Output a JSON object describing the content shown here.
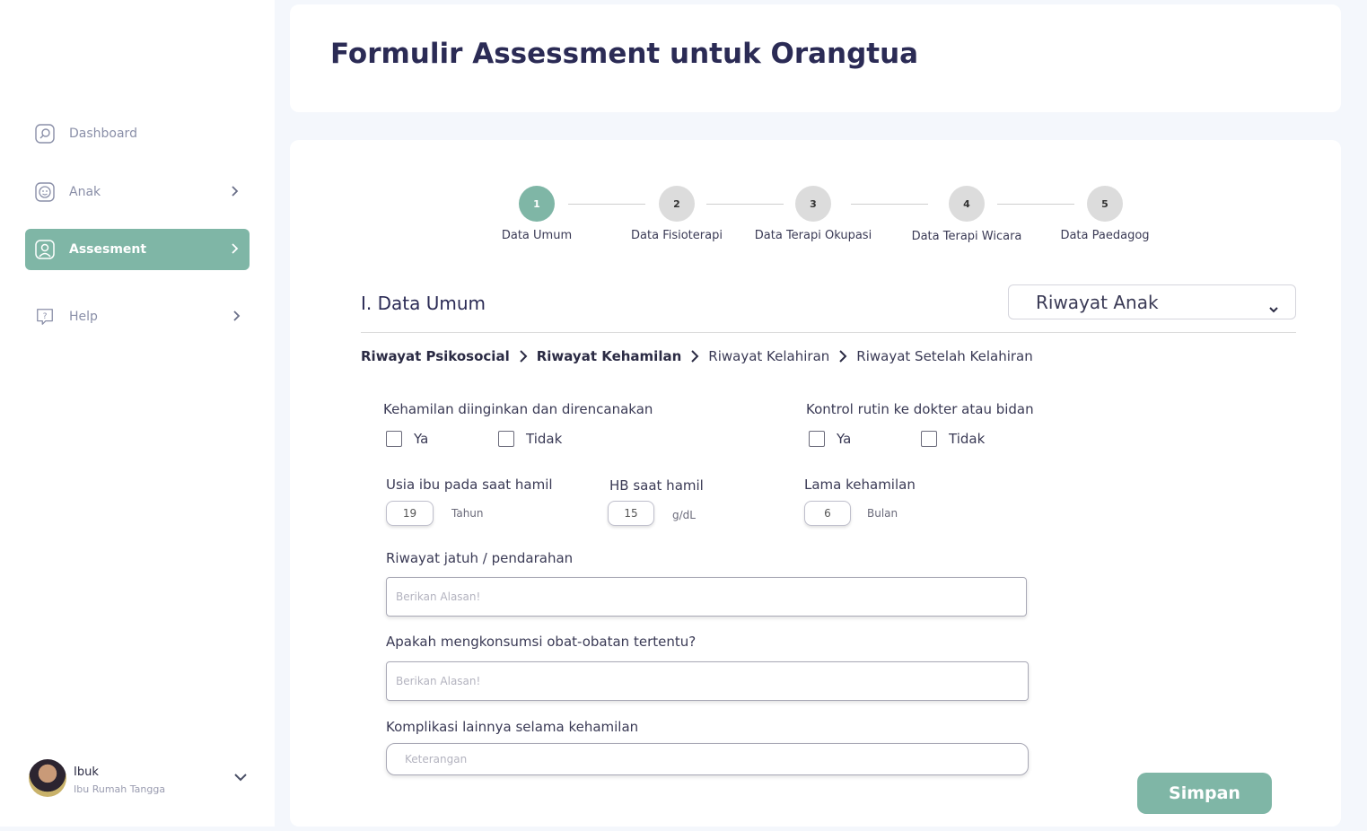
{
  "sidebar": {
    "items": [
      {
        "label": "Dashboard",
        "icon": "dashboard-icon"
      },
      {
        "label": "Anak",
        "icon": "child-icon"
      },
      {
        "label": "Assesment",
        "icon": "user-icon"
      },
      {
        "label": "Help",
        "icon": "help-icon"
      }
    ],
    "user": {
      "name": "Ibuk",
      "role": "Ibu Rumah Tangga"
    }
  },
  "header": {
    "title": "Formulir Assessment untuk Orangtua"
  },
  "stepper": [
    {
      "number": "1",
      "label": "Data Umum"
    },
    {
      "number": "2",
      "label": "Data Fisioterapi"
    },
    {
      "number": "3",
      "label": "Data Terapi Okupasi"
    },
    {
      "number": "4",
      "label": "Data Terapi Wicara"
    },
    {
      "number": "5",
      "label": "Data Paedagog"
    }
  ],
  "section": {
    "title": "I. Data Umum",
    "select_value": "Riwayat Anak"
  },
  "breadcrumb": [
    "Riwayat Psikosocial",
    "Riwayat Kehamilan",
    "Riwayat Kelahiran",
    "Riwayat Setelah Kelahiran"
  ],
  "form": {
    "q1": {
      "label": "Kehamilan diinginkan dan direncanakan",
      "yes": "Ya",
      "no": "Tidak"
    },
    "q2": {
      "label": "Kontrol rutin ke dokter atau bidan",
      "yes": "Ya",
      "no": "Tidak"
    },
    "age": {
      "label": "Usia ibu pada saat hamil",
      "value": "19",
      "unit": "Tahun"
    },
    "hb": {
      "label": "HB saat hamil",
      "value": "15",
      "unit": "g/dL"
    },
    "duration": {
      "label": "Lama kehamilan",
      "value": "6",
      "unit": "Bulan"
    },
    "fall": {
      "label": "Riwayat jatuh / pendarahan",
      "placeholder": "Berikan Alasan!"
    },
    "meds": {
      "label": "Apakah mengkonsumsi obat-obatan tertentu?",
      "placeholder": "Berikan Alasan!"
    },
    "complication": {
      "label": "Komplikasi lainnya selama kehamilan",
      "placeholder": "Keterangan"
    }
  },
  "save_label": "Simpan",
  "colors": {
    "accent": "#7fb6a6",
    "title": "#2b2b55"
  }
}
